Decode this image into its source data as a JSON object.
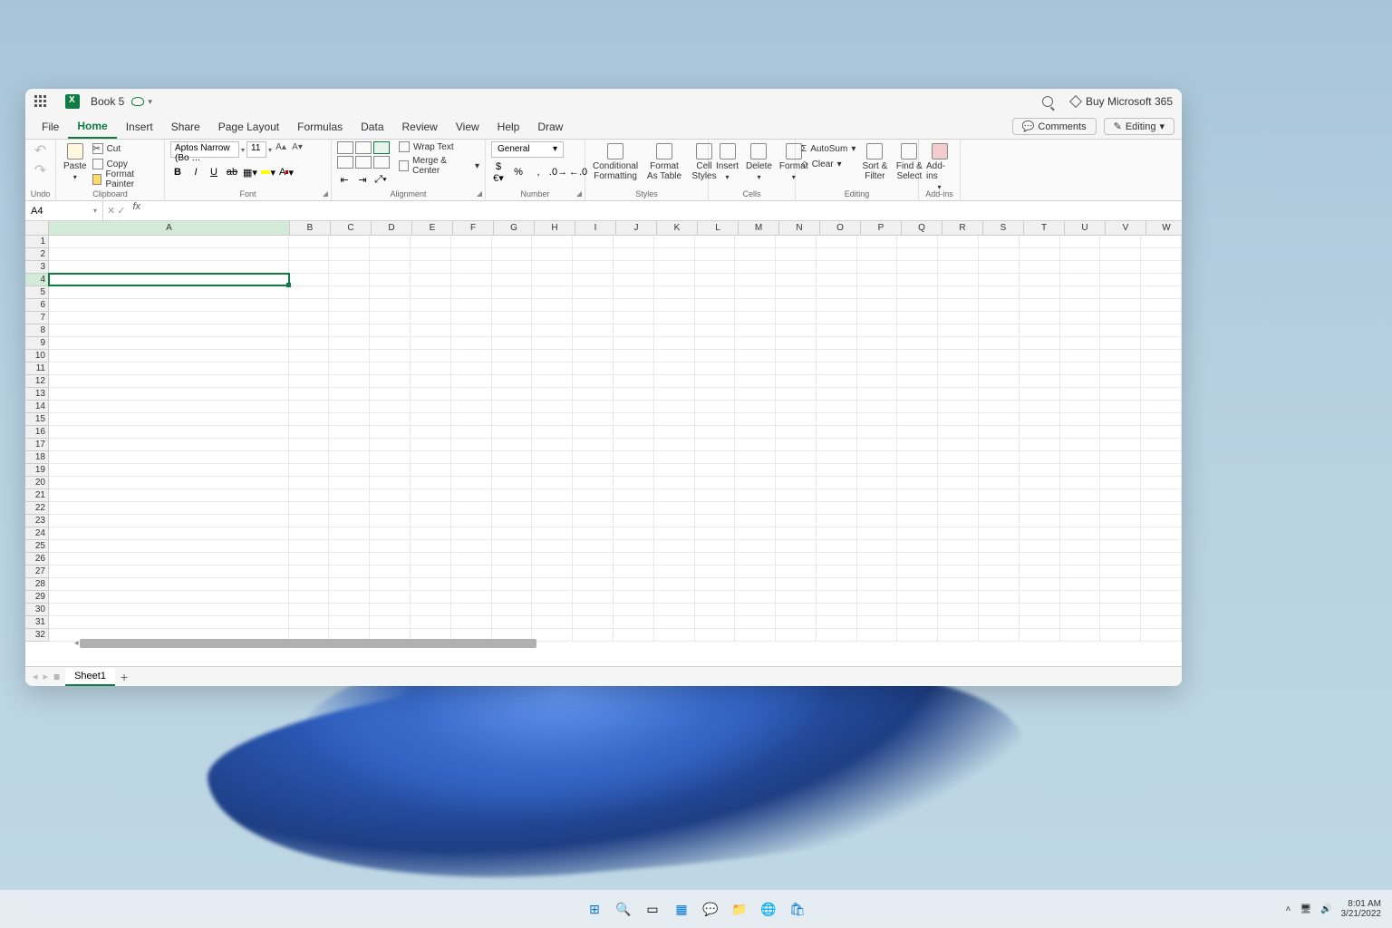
{
  "titlebar": {
    "doc_title": "Book 5",
    "buy_link": "Buy Microsoft 365"
  },
  "tabs": {
    "file": "File",
    "home": "Home",
    "insert": "Insert",
    "share": "Share",
    "page_layout": "Page Layout",
    "formulas": "Formulas",
    "data": "Data",
    "review": "Review",
    "view": "View",
    "help": "Help",
    "draw": "Draw",
    "comments": "Comments",
    "editing": "Editing"
  },
  "ribbon": {
    "undo": "Undo",
    "paste": "Paste",
    "cut": "Cut",
    "copy": "Copy",
    "format_painter": "Format Painter",
    "clipboard": "Clipboard",
    "font_name": "Aptos Narrow (Bo …",
    "font_size": "11",
    "font": "Font",
    "wrap_text": "Wrap Text",
    "merge_center": "Merge & Center",
    "alignment": "Alignment",
    "number_format": "General",
    "number": "Number",
    "cond_fmt": "Conditional Formatting",
    "fmt_table": "Format As Table",
    "cell_styles": "Cell Styles",
    "styles": "Styles",
    "cells_insert": "Insert",
    "cells_delete": "Delete",
    "cells_format": "Format",
    "cells": "Cells",
    "autosum": "AutoSum",
    "clear": "Clear",
    "sort_filter": "Sort & Filter",
    "find_select": "Find & Select",
    "editing_group": "Editing",
    "addins": "Add-ins",
    "addins_group": "Add-ins"
  },
  "formula_bar": {
    "cell_ref": "A4",
    "fx": "fx"
  },
  "columns": [
    "A",
    "B",
    "C",
    "D",
    "E",
    "F",
    "G",
    "H",
    "I",
    "J",
    "K",
    "L",
    "M",
    "N",
    "O",
    "P",
    "Q",
    "R",
    "S",
    "T",
    "U",
    "V",
    "W"
  ],
  "wide_col_index": 0,
  "wide_col_width": 266,
  "normal_col_width": 45,
  "row_count": 32,
  "active_row": 4,
  "active_col": 0,
  "sheet": {
    "name": "Sheet1"
  },
  "systray": {
    "time": "8:01 AM",
    "date": "3/21/2022"
  }
}
